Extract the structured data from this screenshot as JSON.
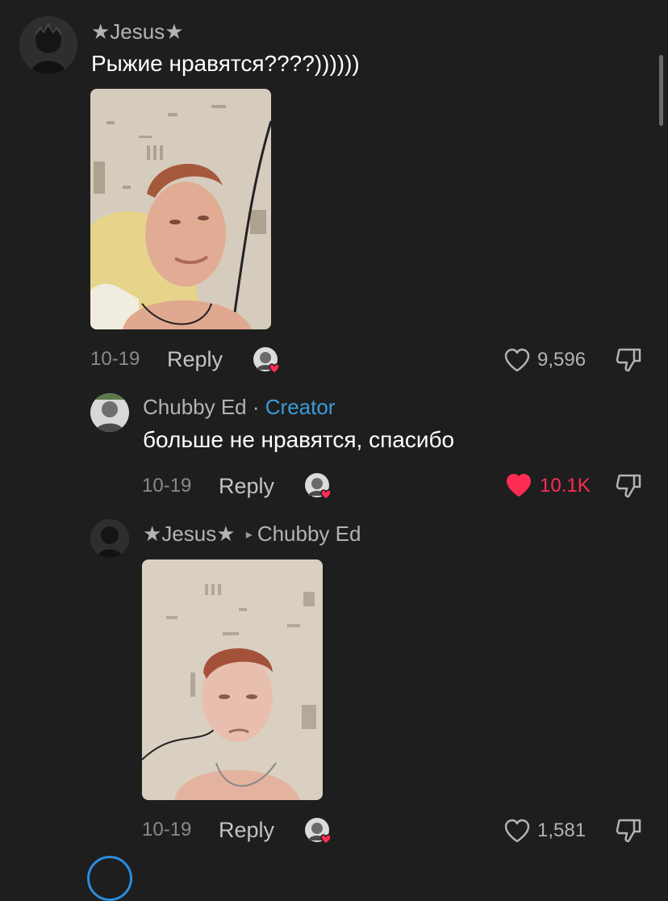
{
  "comments": [
    {
      "username": "★Jesus★",
      "text": "Рыжие нравятся????))))))",
      "date": "10-19",
      "reply_label": "Reply",
      "likes": "9,596",
      "liked": false
    },
    {
      "username": "Chubby Ed",
      "separator": " · ",
      "badge": "Creator",
      "text": "больше не нравятся, спасибо",
      "date": "10-19",
      "reply_label": "Reply",
      "likes": "10.1K",
      "liked": true
    },
    {
      "username": "★Jesus★",
      "reply_to_arrow": "▸",
      "reply_to": "Chubby Ed",
      "date": "10-19",
      "reply_label": "Reply",
      "likes": "1,581",
      "liked": false
    }
  ],
  "colors": {
    "background": "#1e1e1e",
    "creator_badge": "#3a9bd9",
    "liked_heart": "#fe2c55",
    "secondary_text": "#b3b3b3"
  },
  "icons": [
    "heart-icon",
    "heart-filled-icon",
    "dislike-icon",
    "creator-liked-icon"
  ]
}
